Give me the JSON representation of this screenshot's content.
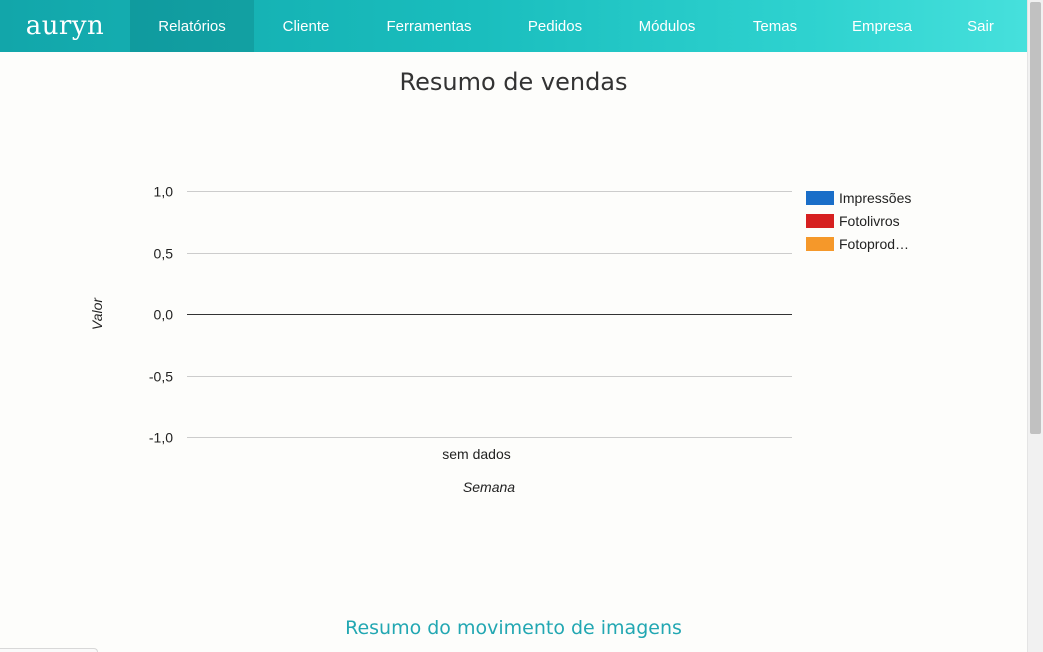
{
  "navbar": {
    "brand": "auryn",
    "items": [
      {
        "label": "Relatórios",
        "active": true
      },
      {
        "label": "Cliente",
        "active": false
      },
      {
        "label": "Ferramentas",
        "active": false
      },
      {
        "label": "Pedidos",
        "active": false
      },
      {
        "label": "Módulos",
        "active": false
      },
      {
        "label": "Temas",
        "active": false
      },
      {
        "label": "Empresa",
        "active": false
      },
      {
        "label": "Sair",
        "active": false
      }
    ]
  },
  "main": {
    "section_title": "Resumo do movimento de imagens"
  },
  "chart_data": {
    "type": "bar",
    "title": "Resumo de vendas",
    "xlabel": "Semana",
    "ylabel": "Valor",
    "categories": [
      "sem dados"
    ],
    "yticks": [
      "1,0",
      "0,5",
      "0,0",
      "-0,5",
      "-1,0"
    ],
    "ytick_values": [
      1.0,
      0.5,
      0.0,
      -0.5,
      -1.0
    ],
    "ylim": [
      -1.0,
      1.0
    ],
    "grid": true,
    "legend_position": "right",
    "series": [
      {
        "name": "Impressões",
        "color": "#1a6ec8",
        "values": []
      },
      {
        "name": "Fotolivros",
        "color": "#d62020",
        "values": []
      },
      {
        "name": "Fotoprod…",
        "color": "#f5982a",
        "values": []
      }
    ]
  }
}
